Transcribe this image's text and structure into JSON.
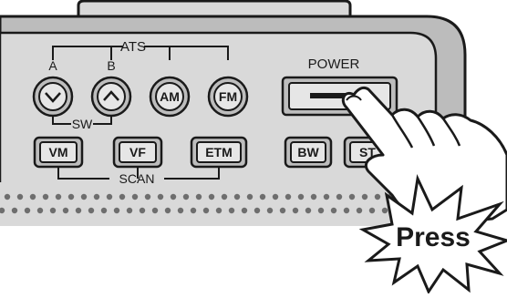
{
  "panel": {
    "ats_label": "ATS",
    "sw_label": "SW",
    "scan_label": "SCAN",
    "a_label": "A",
    "b_label": "B",
    "power_label": "POWER"
  },
  "round_buttons": [
    {
      "name": "sw-down-button",
      "label": "",
      "icon": "chevron-down-icon"
    },
    {
      "name": "sw-up-button",
      "label": "",
      "icon": "chevron-up-icon"
    },
    {
      "name": "am-button",
      "label": "AM"
    },
    {
      "name": "fm-button",
      "label": "FM"
    }
  ],
  "scan_buttons": [
    {
      "name": "vm-button",
      "label": "VM"
    },
    {
      "name": "vf-button",
      "label": "VF"
    },
    {
      "name": "etm-button",
      "label": "ETM"
    },
    {
      "name": "bw-button",
      "label": "BW"
    },
    {
      "name": "st-button",
      "label": "ST"
    }
  ],
  "callout": {
    "text": "Press"
  },
  "colors": {
    "panel": "#d9d9d9",
    "outline": "#1a1a1a",
    "button_face": "#bdbdbd",
    "dot": "#6e6e6e"
  }
}
